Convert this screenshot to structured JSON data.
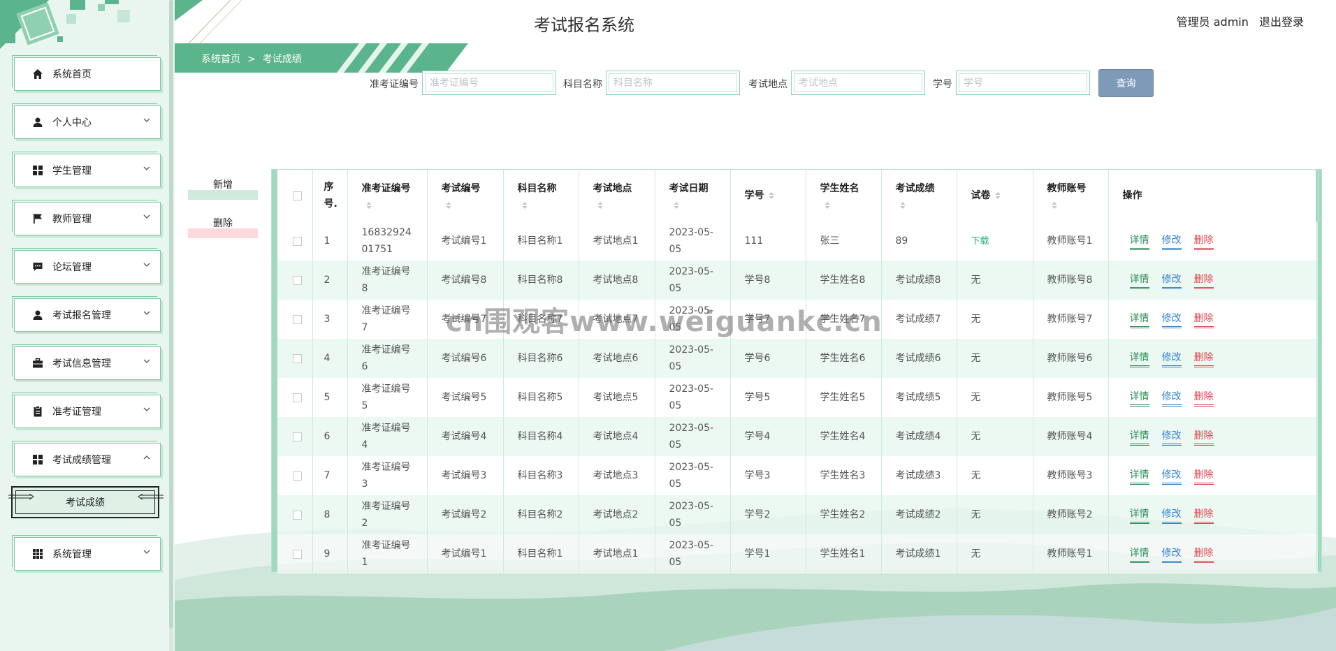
{
  "app": {
    "title": "考试报名系统",
    "user_label": "管理员 admin",
    "logout_label": "退出登录"
  },
  "breadcrumb": {
    "home": "系统首页",
    "separator": ">",
    "current": "考试成绩"
  },
  "sidebar": {
    "items": [
      {
        "label": "系统首页",
        "icon": "home-icon"
      },
      {
        "label": "个人中心",
        "icon": "user-icon"
      },
      {
        "label": "学生管理",
        "icon": "grid-icon"
      },
      {
        "label": "教师管理",
        "icon": "flag-icon"
      },
      {
        "label": "论坛管理",
        "icon": "chat-icon"
      },
      {
        "label": "考试报名管理",
        "icon": "user-icon"
      },
      {
        "label": "考试信息管理",
        "icon": "briefcase-icon"
      },
      {
        "label": "准考证管理",
        "icon": "clipboard-icon"
      },
      {
        "label": "考试成绩管理",
        "icon": "grid-icon",
        "expanded": true
      },
      {
        "label": "系统管理",
        "icon": "apps-icon"
      }
    ],
    "submenu": {
      "label": "考试成绩"
    }
  },
  "search": {
    "fields": [
      {
        "label": "准考证编号",
        "placeholder": "准考证编号"
      },
      {
        "label": "科目名称",
        "placeholder": "科目名称"
      },
      {
        "label": "考试地点",
        "placeholder": "考试地点"
      },
      {
        "label": "学号",
        "placeholder": "学号"
      }
    ],
    "query_label": "查询"
  },
  "actions": {
    "add_label": "新增",
    "delete_label": "删除"
  },
  "table": {
    "headers": [
      "序号.",
      "准考证编号",
      "考试编号",
      "科目名称",
      "考试地点",
      "考试日期",
      "学号",
      "学生姓名",
      "考试成绩",
      "试卷",
      "教师账号",
      "操作"
    ],
    "ops": {
      "detail": "详情",
      "edit": "修改",
      "delete": "删除"
    },
    "rows": [
      {
        "idx": "1",
        "ticket": "1683292401751",
        "exam_no": "考试编号1",
        "subject": "科目名称1",
        "location": "考试地点1",
        "date": "2023-05-05",
        "student_no": "111",
        "student_name": "张三",
        "score": "89",
        "paper": "下载",
        "paper_link": true,
        "teacher": "教师账号1"
      },
      {
        "idx": "2",
        "ticket": "准考证编号8",
        "exam_no": "考试编号8",
        "subject": "科目名称8",
        "location": "考试地点8",
        "date": "2023-05-05",
        "student_no": "学号8",
        "student_name": "学生姓名8",
        "score": "考试成绩8",
        "paper": "无",
        "paper_link": false,
        "teacher": "教师账号8"
      },
      {
        "idx": "3",
        "ticket": "准考证编号7",
        "exam_no": "考试编号7",
        "subject": "科目名称7",
        "location": "考试地点7",
        "date": "2023-05-05",
        "student_no": "学号7",
        "student_name": "学生姓名7",
        "score": "考试成绩7",
        "paper": "无",
        "paper_link": false,
        "teacher": "教师账号7"
      },
      {
        "idx": "4",
        "ticket": "准考证编号6",
        "exam_no": "考试编号6",
        "subject": "科目名称6",
        "location": "考试地点6",
        "date": "2023-05-05",
        "student_no": "学号6",
        "student_name": "学生姓名6",
        "score": "考试成绩6",
        "paper": "无",
        "paper_link": false,
        "teacher": "教师账号6"
      },
      {
        "idx": "5",
        "ticket": "准考证编号5",
        "exam_no": "考试编号5",
        "subject": "科目名称5",
        "location": "考试地点5",
        "date": "2023-05-05",
        "student_no": "学号5",
        "student_name": "学生姓名5",
        "score": "考试成绩5",
        "paper": "无",
        "paper_link": false,
        "teacher": "教师账号5"
      },
      {
        "idx": "6",
        "ticket": "准考证编号4",
        "exam_no": "考试编号4",
        "subject": "科目名称4",
        "location": "考试地点4",
        "date": "2023-05-05",
        "student_no": "学号4",
        "student_name": "学生姓名4",
        "score": "考试成绩4",
        "paper": "无",
        "paper_link": false,
        "teacher": "教师账号4"
      },
      {
        "idx": "7",
        "ticket": "准考证编号3",
        "exam_no": "考试编号3",
        "subject": "科目名称3",
        "location": "考试地点3",
        "date": "2023-05-05",
        "student_no": "学号3",
        "student_name": "学生姓名3",
        "score": "考试成绩3",
        "paper": "无",
        "paper_link": false,
        "teacher": "教师账号3"
      },
      {
        "idx": "8",
        "ticket": "准考证编号2",
        "exam_no": "考试编号2",
        "subject": "科目名称2",
        "location": "考试地点2",
        "date": "2023-05-05",
        "student_no": "学号2",
        "student_name": "学生姓名2",
        "score": "考试成绩2",
        "paper": "无",
        "paper_link": false,
        "teacher": "教师账号2"
      },
      {
        "idx": "9",
        "ticket": "准考证编号1",
        "exam_no": "考试编号1",
        "subject": "科目名称1",
        "location": "考试地点1",
        "date": "2023-05-05",
        "student_no": "学号1",
        "student_name": "学生姓名1",
        "score": "考试成绩1",
        "paper": "无",
        "paper_link": false,
        "teacher": "教师账号1"
      }
    ]
  },
  "watermark": "cn围观客www.weiguankc.cn",
  "colors": {
    "primary_green": "#5bb58c",
    "sidebar_bg": "#e9f6ef",
    "query_button": "#7f9ab8",
    "detail": "#2e8b57",
    "edit": "#2f7fd0",
    "delete": "#e0454d"
  }
}
